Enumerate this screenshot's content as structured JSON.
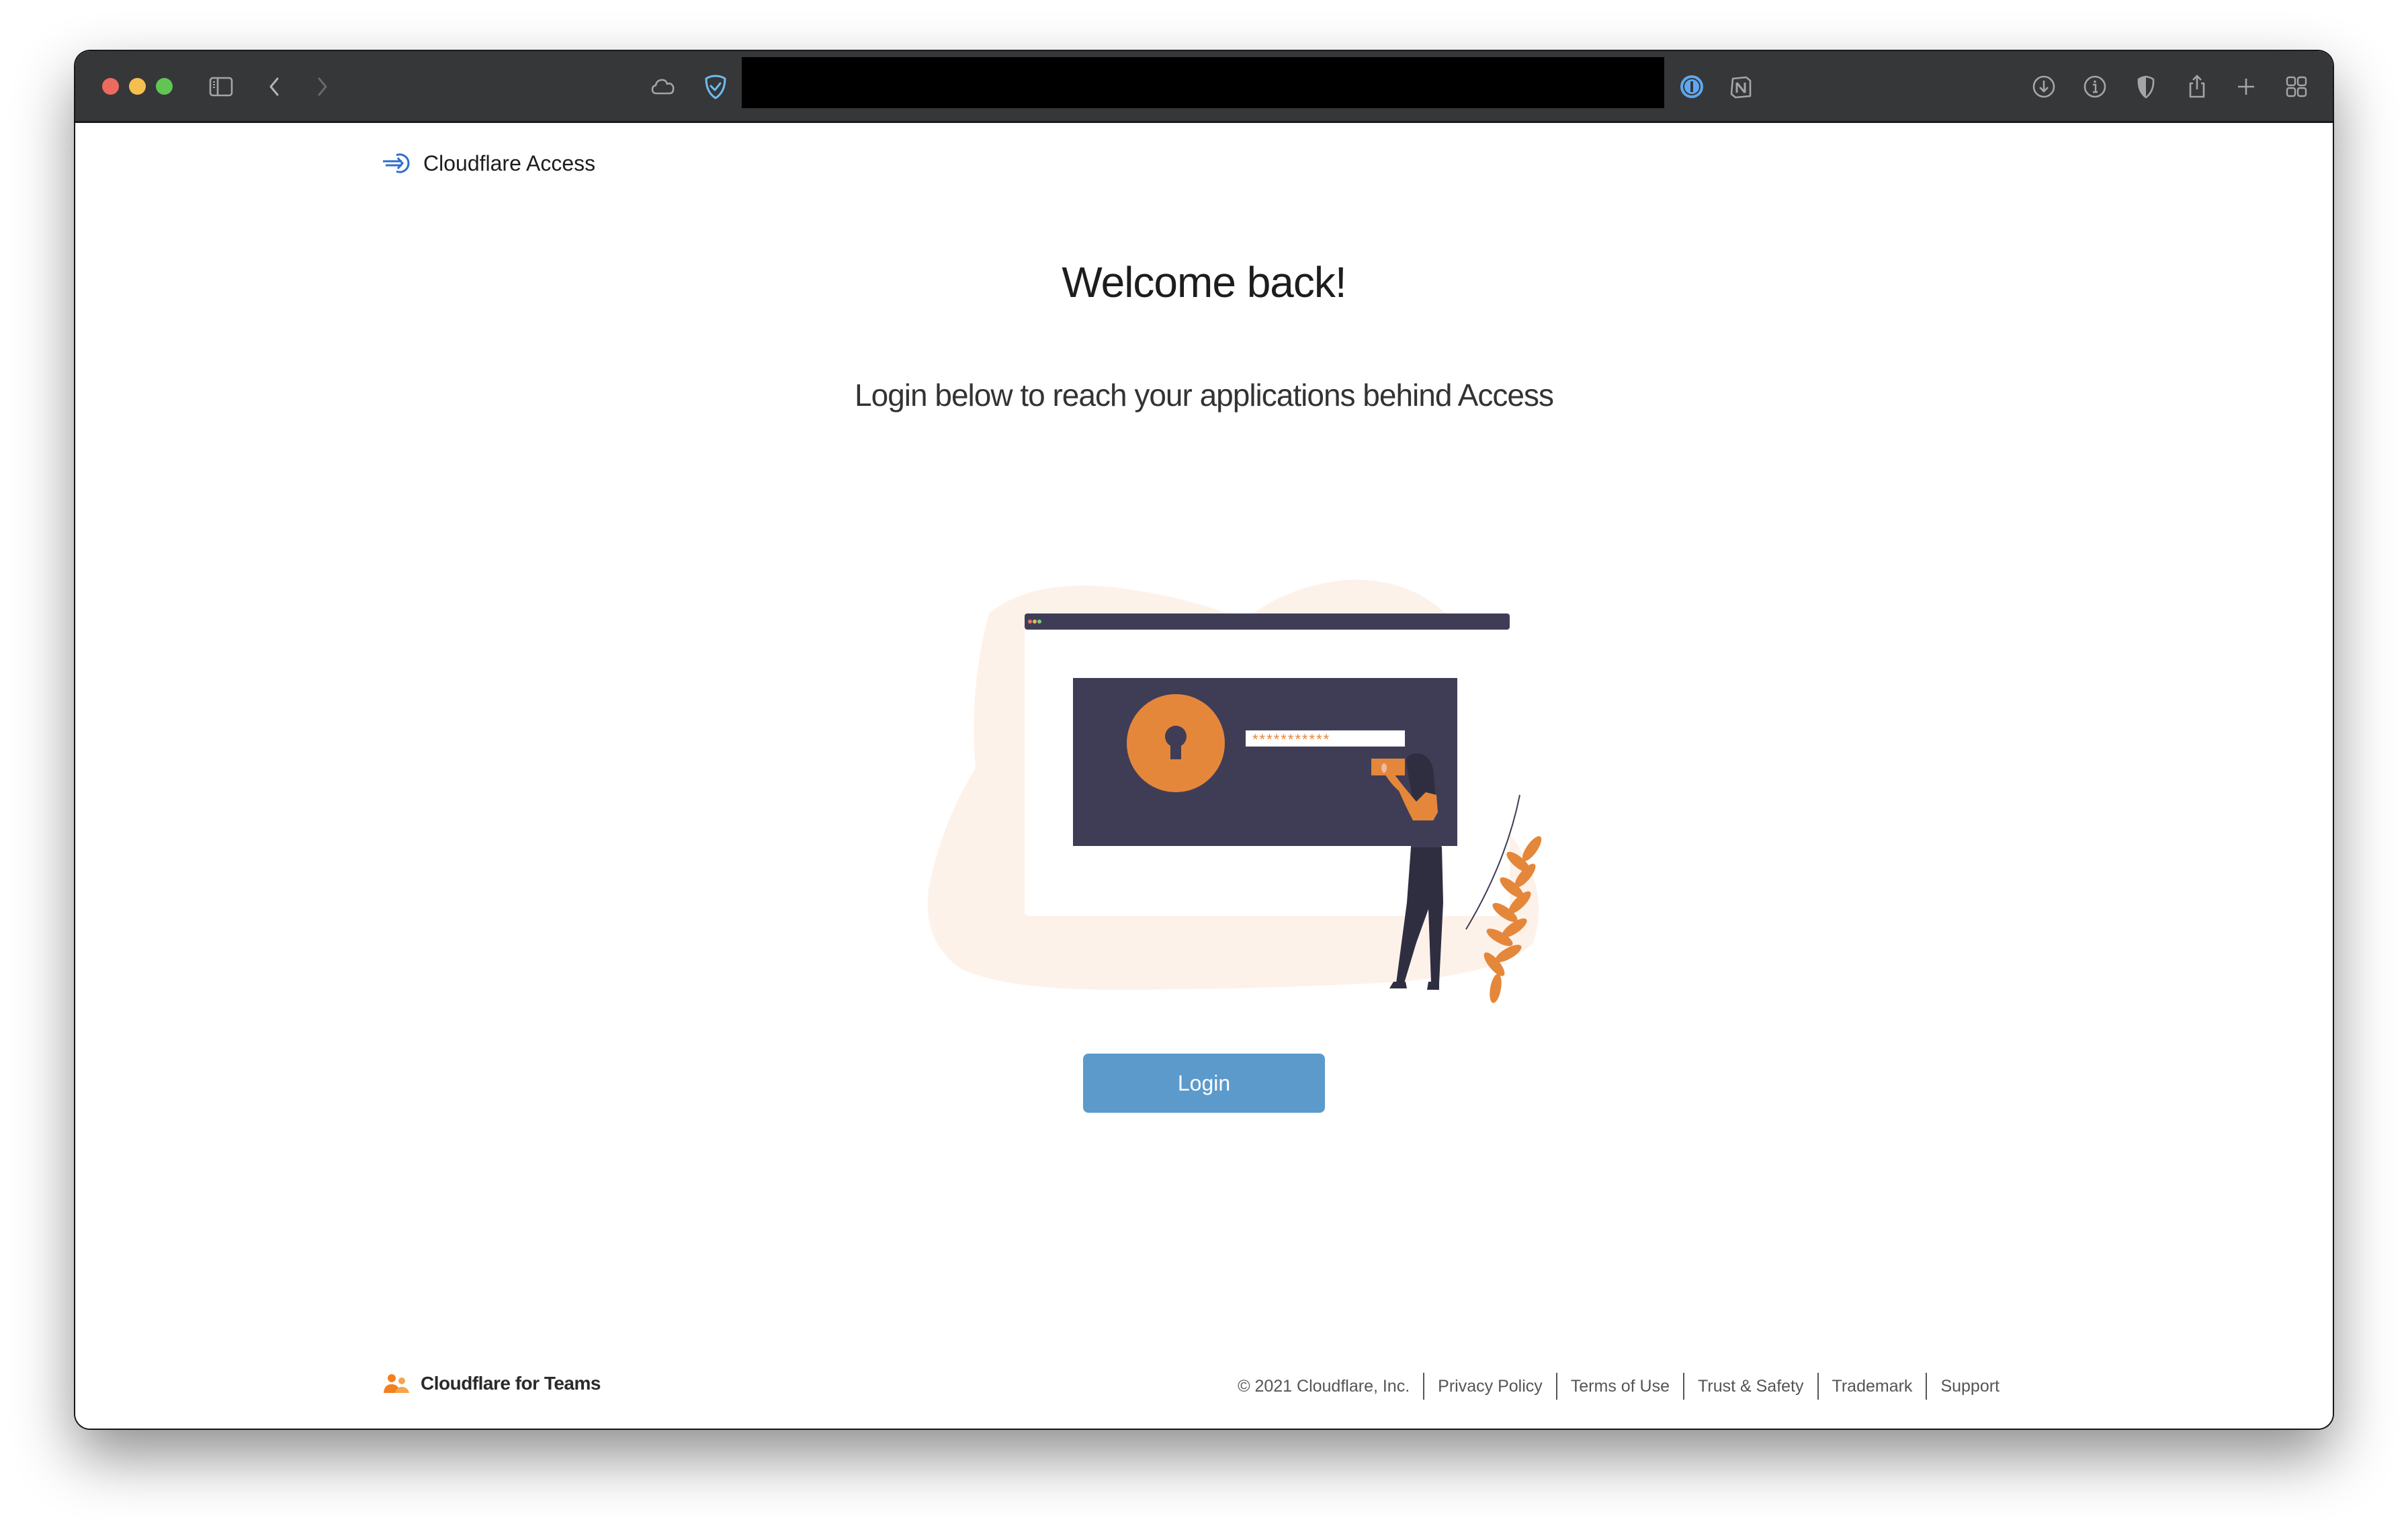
{
  "browser": {
    "window_controls": [
      "close",
      "minimize",
      "zoom"
    ],
    "left_icons": [
      "sidebar-icon",
      "back-icon",
      "forward-icon"
    ],
    "address_icons": [
      "icloud-icon",
      "adguard-shield-icon"
    ],
    "extension_icons": [
      "onepassword-icon",
      "notion-icon"
    ],
    "right_icons": [
      "download-icon",
      "info-icon",
      "privacy-shield-icon",
      "share-icon",
      "new-tab-icon",
      "tab-overview-icon"
    ],
    "address_redacted": true
  },
  "header": {
    "brand_label": "Cloudflare Access"
  },
  "main": {
    "title": "Welcome back!",
    "subtitle": "Login below to reach your applications behind Access",
    "illustration": {
      "password_mask": "***********",
      "colors": {
        "dark": "#3f3d56",
        "accent": "#e5873a",
        "blob": "#fdf2ea"
      }
    },
    "login_button": "Login"
  },
  "footer": {
    "brand_label": "Cloudflare for Teams",
    "copyright": "© 2021 Cloudflare, Inc.",
    "links": [
      "Privacy Policy",
      "Terms of Use",
      "Trust & Safety",
      "Trademark",
      "Support"
    ]
  },
  "colors": {
    "toolbar": "#363739",
    "button": "#5c9acb",
    "brand_blue": "#2f6fd0",
    "brand_orange": "#f38020"
  }
}
